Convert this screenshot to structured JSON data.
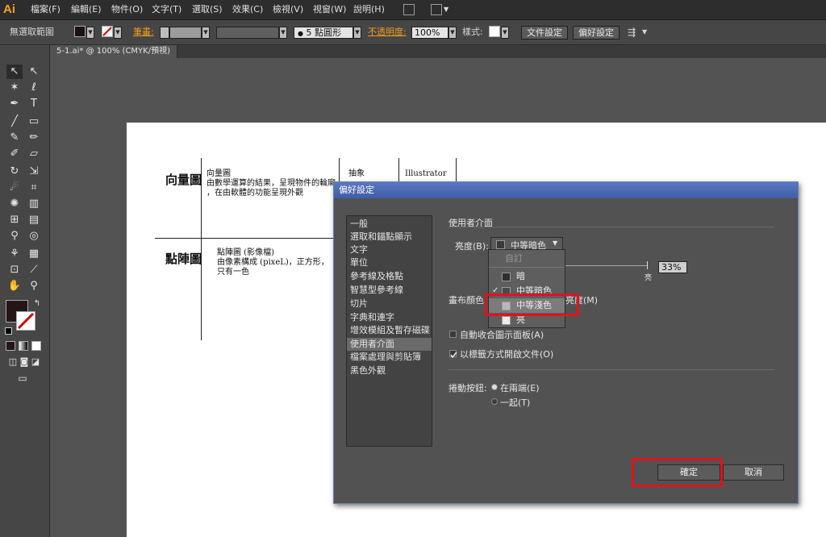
{
  "app": {
    "logo": "Ai"
  },
  "menubar": {
    "items": [
      "檔案(F)",
      "編輯(E)",
      "物件(O)",
      "文字(T)",
      "選取(S)",
      "效果(C)",
      "檢視(V)",
      "視窗(W)",
      "說明(H)"
    ]
  },
  "control": {
    "selection": "無選取範圍",
    "stroke_label": "筆畫:",
    "brush": "5 點圓形",
    "opacity_label": "不透明度:",
    "opacity": "100%",
    "style_label": "樣式:",
    "doc_setup": "文件設定",
    "prefs": "偏好設定"
  },
  "document": {
    "tab": "5-1.ai* @ 100% (CMYK/預視)"
  },
  "artboard": {
    "vector_heading": "向量圖",
    "vector_title": "向量圖",
    "vector_line1": "由數學運算的結果，呈現物件的輪廓",
    "vector_line2": "，在由軟體的功能呈現外觀",
    "col_abstract": "抽象",
    "col_app": "Illustrator",
    "bitmap_heading": "點陣圖",
    "bitmap_title": "點陣圖 (影像檔)",
    "bitmap_line1": "由像素構成 (pixeL)，正方形，",
    "bitmap_line2": "只有一色"
  },
  "dialog": {
    "title": "偏好設定",
    "categories": [
      "一般",
      "選取和錨點顯示",
      "文字",
      "單位",
      "參考線及格點",
      "智慧型參考線",
      "切片",
      "字典和連字",
      "增效模組及暫存磁碟",
      "使用者介面",
      "檔案處理與剪貼簿",
      "黑色外觀"
    ],
    "selected_category": "使用者介面",
    "section_title": "使用者介面",
    "brightness_label": "亮度(B):",
    "brightness_value": "中等暗色",
    "slider_value": "33%",
    "slider_end_label": "亮",
    "canvas_label": "畫布顏色",
    "canvas_option": "亮度(M)",
    "auto_collapse": "自動收合圖示面板(A)",
    "open_in_tabs": "以標籤方式開啟文件(O)",
    "scroll_label": "捲動按鈕:",
    "scroll_opt1": "在兩端(E)",
    "scroll_opt2": "一起(T)",
    "ok": "確定",
    "cancel": "取消"
  },
  "popup": {
    "header": "自訂",
    "options": [
      "暗",
      "中等暗色",
      "中等淺色",
      "亮"
    ],
    "checked": "中等暗色",
    "highlighted": "中等淺色"
  },
  "colors": {
    "accent_orange": "#f39a1e",
    "highlight_red": "#e0131b",
    "title_blue": "#4a68b5"
  }
}
